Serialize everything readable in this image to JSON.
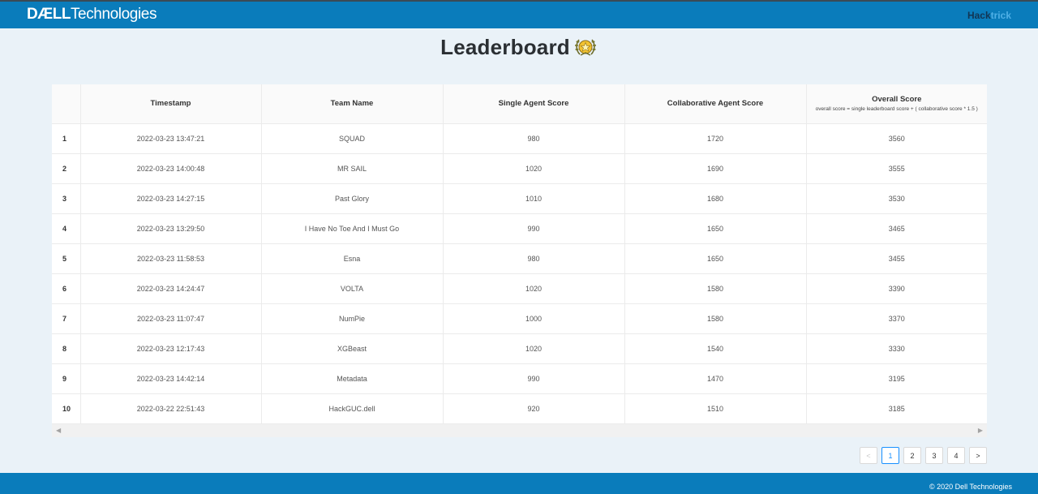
{
  "header": {
    "brand_bold": "DÆLL",
    "brand_light": "Technologies",
    "hack_part1": "Hack",
    "hack_part2": "trick"
  },
  "page": {
    "title": "Leaderboard"
  },
  "table": {
    "columns": {
      "timestamp": "Timestamp",
      "team": "Team Name",
      "single": "Single Agent Score",
      "collab": "Collaborative Agent Score",
      "overall": "Overall Score",
      "overall_formula": "overall score = single leaderboard score + ( collaborative score * 1.5 )"
    },
    "rows": [
      {
        "rank": "1",
        "timestamp": "2022-03-23 13:47:21",
        "team": "SQUAD",
        "single": "980",
        "collab": "1720",
        "overall": "3560"
      },
      {
        "rank": "2",
        "timestamp": "2022-03-23 14:00:48",
        "team": "MR SAIL",
        "single": "1020",
        "collab": "1690",
        "overall": "3555"
      },
      {
        "rank": "3",
        "timestamp": "2022-03-23 14:27:15",
        "team": "Past Glory",
        "single": "1010",
        "collab": "1680",
        "overall": "3530"
      },
      {
        "rank": "4",
        "timestamp": "2022-03-23 13:29:50",
        "team": "I Have No Toe And I Must Go",
        "single": "990",
        "collab": "1650",
        "overall": "3465"
      },
      {
        "rank": "5",
        "timestamp": "2022-03-23 11:58:53",
        "team": "Esna",
        "single": "980",
        "collab": "1650",
        "overall": "3455"
      },
      {
        "rank": "6",
        "timestamp": "2022-03-23 14:24:47",
        "team": "VOLTA",
        "single": "1020",
        "collab": "1580",
        "overall": "3390"
      },
      {
        "rank": "7",
        "timestamp": "2022-03-23 11:07:47",
        "team": "NumPie",
        "single": "1000",
        "collab": "1580",
        "overall": "3370"
      },
      {
        "rank": "8",
        "timestamp": "2022-03-23 12:17:43",
        "team": "XGBeast",
        "single": "1020",
        "collab": "1540",
        "overall": "3330"
      },
      {
        "rank": "9",
        "timestamp": "2022-03-23 14:42:14",
        "team": "Metadata",
        "single": "990",
        "collab": "1470",
        "overall": "3195"
      },
      {
        "rank": "10",
        "timestamp": "2022-03-22 22:51:43",
        "team": "HackGUC.dell",
        "single": "920",
        "collab": "1510",
        "overall": "3185"
      }
    ]
  },
  "pagination": {
    "prev": "<",
    "pages": [
      "1",
      "2",
      "3",
      "4"
    ],
    "current": "1",
    "next": ">"
  },
  "footer": {
    "copyright": "© 2020 Dell Technologies"
  },
  "icons": {
    "trophy": "trophy-icon",
    "scroll_left": "scroll-left-arrow-icon",
    "scroll_right": "scroll-right-arrow-icon"
  },
  "colors": {
    "header_bg": "#0a7cbb",
    "page_bg": "#eaf2f8",
    "accent": "#1890ff",
    "trophy_gold": "#f2c230"
  }
}
